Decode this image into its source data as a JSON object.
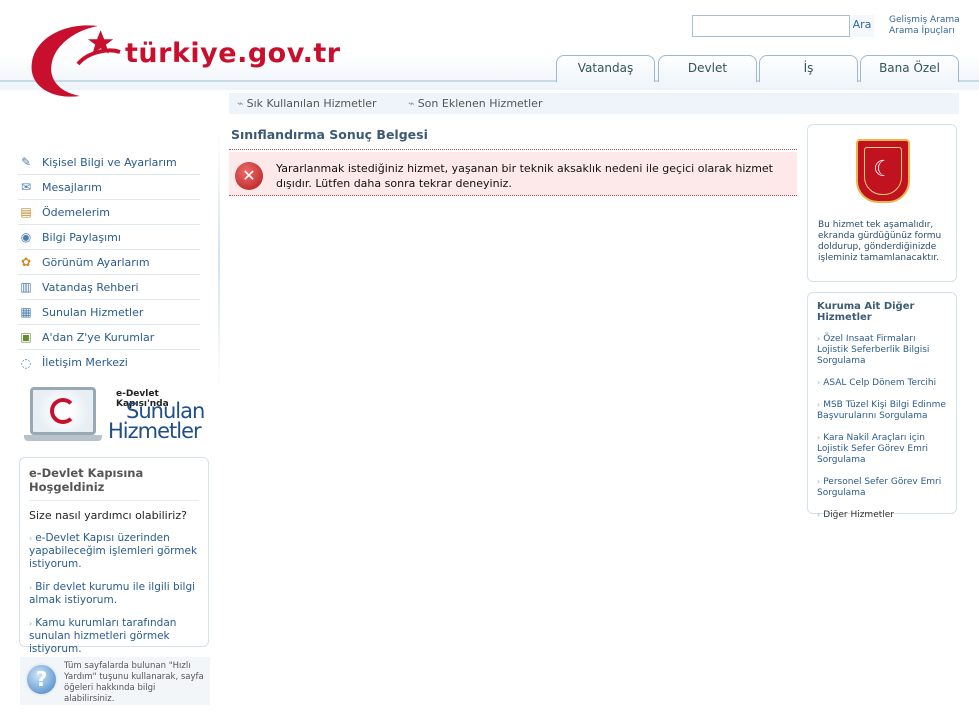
{
  "header": {
    "logo_text": "türkiye.gov.tr",
    "search_button": "Ara",
    "advanced_search": "Gelişmiş Arama",
    "search_tips": "Arama İpuçları"
  },
  "tabs": [
    "Vatandaş",
    "Devlet",
    "İş",
    "Bana Özel"
  ],
  "sub_nav": {
    "frequent": "Sık Kullanılan Hizmetler",
    "recent": "Son Eklenen Hizmetler"
  },
  "left_menu": [
    {
      "label": "Kişisel Bilgi ve Ayarlarım",
      "icon": "profile-icon"
    },
    {
      "label": "Mesajlarım",
      "icon": "envelope-icon"
    },
    {
      "label": "Ödemelerim",
      "icon": "payment-icon"
    },
    {
      "label": "Bilgi Paylaşımı",
      "icon": "share-icon"
    },
    {
      "label": "Görünüm Ayarlarım",
      "icon": "palette-icon"
    },
    {
      "label": "Vatandaş Rehberi",
      "icon": "book-icon"
    },
    {
      "label": "Sunulan Hizmetler",
      "icon": "services-icon"
    },
    {
      "label": "A'dan Z'ye Kurumlar",
      "icon": "building-icon"
    },
    {
      "label": "İletişim Merkezi",
      "icon": "chat-icon"
    }
  ],
  "banner": {
    "line1": "e-Devlet Kapısı'nda",
    "line2": "Sunulan",
    "line3": "Hizmetler"
  },
  "welcome": {
    "title": "e-Devlet Kapısına Hoşgeldiniz",
    "question": "Size nasıl yardımcı olabiliriz?",
    "links": [
      "e-Devlet Kapısı üzerinden yapabileceğim işlemleri görmek istiyorum.",
      "Bir devlet kurumu ile ilgili bilgi almak istiyorum.",
      "Kamu kurumları tarafından sunulan hizmetleri görmek istiyorum."
    ]
  },
  "help": {
    "text": "Tüm sayfalarda bulunan \"Hızlı Yardım\" tuşunu kullanarak, sayfa öğeleri hakkında bilgi alabilirsiniz.",
    "icon_glyph": "?"
  },
  "main": {
    "title": "Sınıflandırma Sonuç Belgesi",
    "alert_text": "Yararlanmak istediğiniz hizmet, yaşanan bir teknik aksaklık nedeni ile geçici olarak hizmet dışıdır. Lütfen daha sonra tekrar deneyiniz."
  },
  "right_box1": {
    "text": "Bu hizmet tek aşamalıdır, ekranda gürdüğünüz formu doldurup, gönderdiğinizde işleminiz tamamlanacaktır."
  },
  "right_box2": {
    "title": "Kuruma Ait Diğer Hizmetler",
    "links": [
      "Özel Insaat Firmaları Lojistik Seferberlik Bilgisi Sorgulama",
      "ASAL Celp Dönem Tercihi",
      "MSB Tüzel Kişi Bilgi Edinme Başvurularını Sorgulama",
      "Kara Nakil Araçları için Lojistik Sefer Görev Emri Sorgulama",
      "Personel Sefer Görev Emri Sorgulama"
    ],
    "other": "Diğer Hizmetler"
  },
  "colors": {
    "brand_red": "#c8102e",
    "link_blue": "#2a5b8c",
    "alert_bg": "#fde9e9"
  }
}
